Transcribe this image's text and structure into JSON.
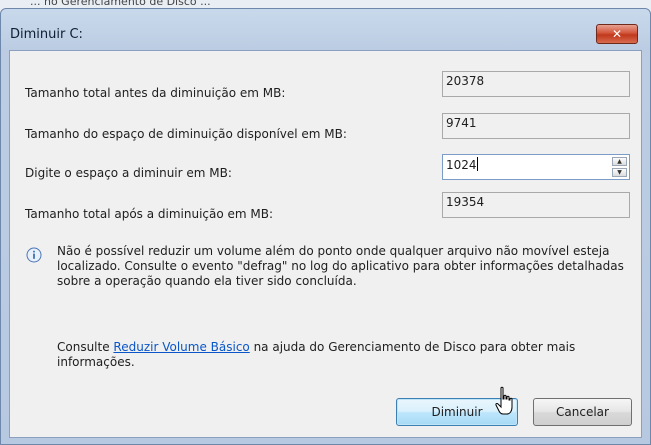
{
  "background_text": "... no Gerenciamento de Disco ...",
  "dialog": {
    "title": "Diminuir C:",
    "close_label": "✕",
    "rows": [
      {
        "label": "Tamanho total antes da diminuição em MB:",
        "value": "20378"
      },
      {
        "label": "Tamanho do espaço de diminuição disponível em MB:",
        "value": "9741"
      },
      {
        "label": "Digite o espaço a diminuir em MB:",
        "value": "1024"
      },
      {
        "label": "Tamanho total após a diminuição em MB:",
        "value": "19354"
      }
    ],
    "info_text": "Não é possível reduzir um volume além do ponto onde qualquer arquivo não movível esteja localizado. Consulte o evento \"defrag\" no log do aplicativo para obter informações detalhadas sobre a operação quando ela tiver sido concluída.",
    "help_prefix": "Consulte ",
    "help_link": "Reduzir Volume Básico",
    "help_suffix": " na ajuda do Gerenciamento de Disco para obter mais informações.",
    "buttons": {
      "primary": "Diminuir",
      "cancel": "Cancelar"
    }
  },
  "colors": {
    "accent": "#0a56c8",
    "close_red": "#c0381c"
  }
}
